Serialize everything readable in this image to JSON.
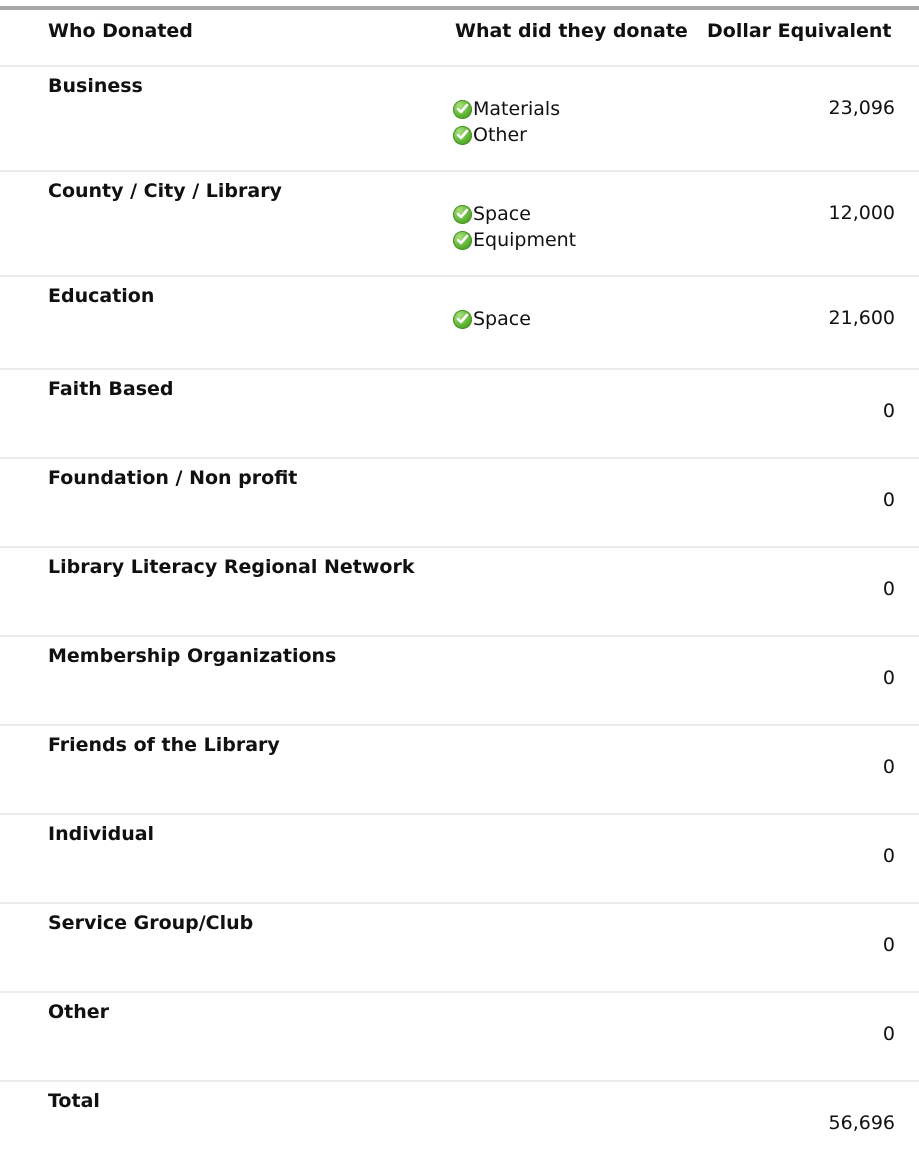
{
  "table": {
    "headers": {
      "who": "Who Donated",
      "what": "What did they donate",
      "dollar": "Dollar Equivalent"
    },
    "rows": [
      {
        "who": "Business",
        "items": [
          "Materials",
          "Other"
        ],
        "amount": "23,096"
      },
      {
        "who": "County / City / Library",
        "items": [
          "Space",
          "Equipment"
        ],
        "amount": "12,000"
      },
      {
        "who": "Education",
        "items": [
          "Space"
        ],
        "amount": "21,600"
      },
      {
        "who": "Faith Based",
        "items": [],
        "amount": "0"
      },
      {
        "who": "Foundation / Non profit",
        "items": [],
        "amount": "0"
      },
      {
        "who": "Library Literacy Regional Network",
        "items": [],
        "amount": "0"
      },
      {
        "who": "Membership Organizations",
        "items": [],
        "amount": "0"
      },
      {
        "who": "Friends of the Library",
        "items": [],
        "amount": "0"
      },
      {
        "who": "Individual",
        "items": [],
        "amount": "0"
      },
      {
        "who": "Service Group/Club",
        "items": [],
        "amount": "0"
      },
      {
        "who": "Other",
        "items": [],
        "amount": "0"
      }
    ],
    "total": {
      "label": "Total",
      "amount": "56,696"
    }
  },
  "icons": {
    "check": "check-circle-icon"
  },
  "colors": {
    "check_green": "#5fb536",
    "top_rule": "#a6a6a6",
    "row_divider": "#ececec"
  }
}
